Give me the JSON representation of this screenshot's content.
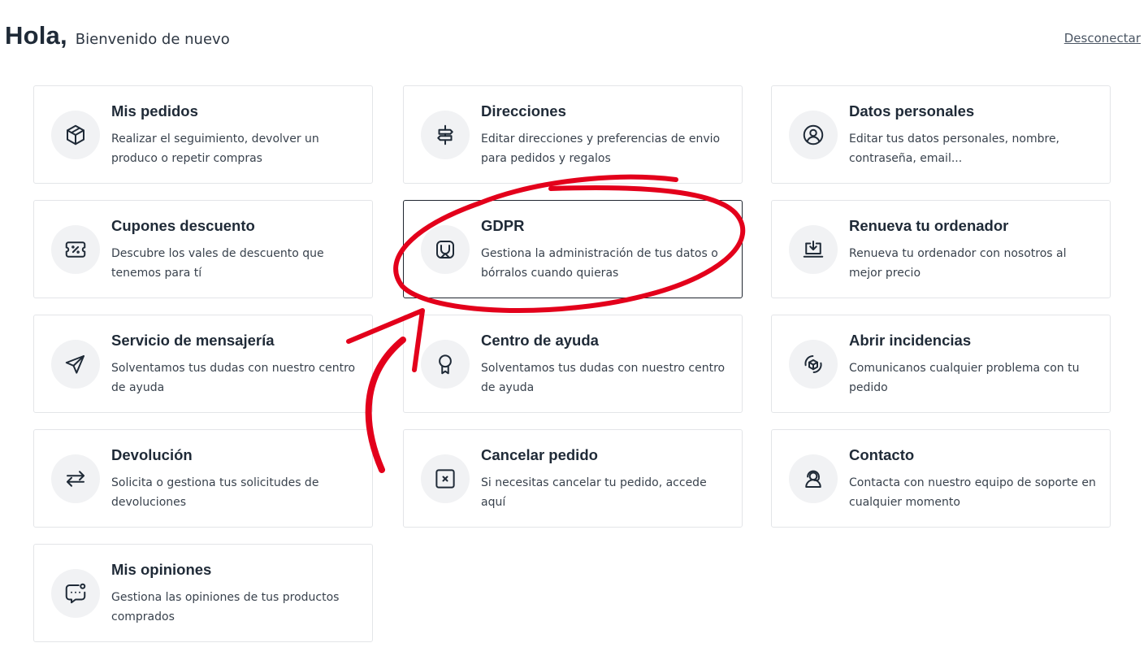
{
  "header": {
    "greeting": "Hola,",
    "subtitle": "Bienvenido de nuevo",
    "logout_label": "Desconectar"
  },
  "cards": [
    {
      "title": "Mis pedidos",
      "description": "Realizar el seguimiento, devolver un produco o repetir compras",
      "icon": "box-icon"
    },
    {
      "title": "Direcciones",
      "description": "Editar direcciones y preferencias de envio para pedidos y regalos",
      "icon": "signpost-icon"
    },
    {
      "title": "Datos personales",
      "description": "Editar tus datos personales, nombre, contraseña, email...",
      "icon": "user-circle-icon"
    },
    {
      "title": "Cupones descuento",
      "description": "Descubre los vales de descuento que tenemos para tí",
      "icon": "ticket-icon"
    },
    {
      "title": "GDPR",
      "description": "Gestiona la administración de tus datos o bórralos cuando quieras",
      "icon": "shield-icon"
    },
    {
      "title": "Renueva tu ordenador",
      "description": "Renueva tu ordenador con nosotros al mejor precio",
      "icon": "laptop-download-icon"
    },
    {
      "title": "Servicio de mensajería",
      "description": "Solventamos tus dudas con nuestro centro de ayuda",
      "icon": "send-icon"
    },
    {
      "title": "Centro de ayuda",
      "description": "Solventamos tus dudas con nuestro centro de ayuda",
      "icon": "award-icon"
    },
    {
      "title": "Abrir incidencias",
      "description": "Comunicanos cualquier problema con tu pedido",
      "icon": "box-rotate-icon"
    },
    {
      "title": "Devolución",
      "description": "Solicita o gestiona tus solicitudes de devoluciones",
      "icon": "arrows-exchange-icon"
    },
    {
      "title": "Cancelar pedido",
      "description": "Si necesitas cancelar tu pedido, accede aquí",
      "icon": "square-x-icon"
    },
    {
      "title": "Contacto",
      "description": "Contacta con nuestro equipo de soporte en cualquier momento",
      "icon": "headset-icon"
    },
    {
      "title": "Mis opiniones",
      "description": "Gestiona las opiniones de tus productos comprados",
      "icon": "message-dots-icon"
    }
  ],
  "colors": {
    "annotation_red": "#e3001b",
    "card_border": "#e3e5e8",
    "active_border": "#202630",
    "icon_bg": "#f1f2f4"
  }
}
